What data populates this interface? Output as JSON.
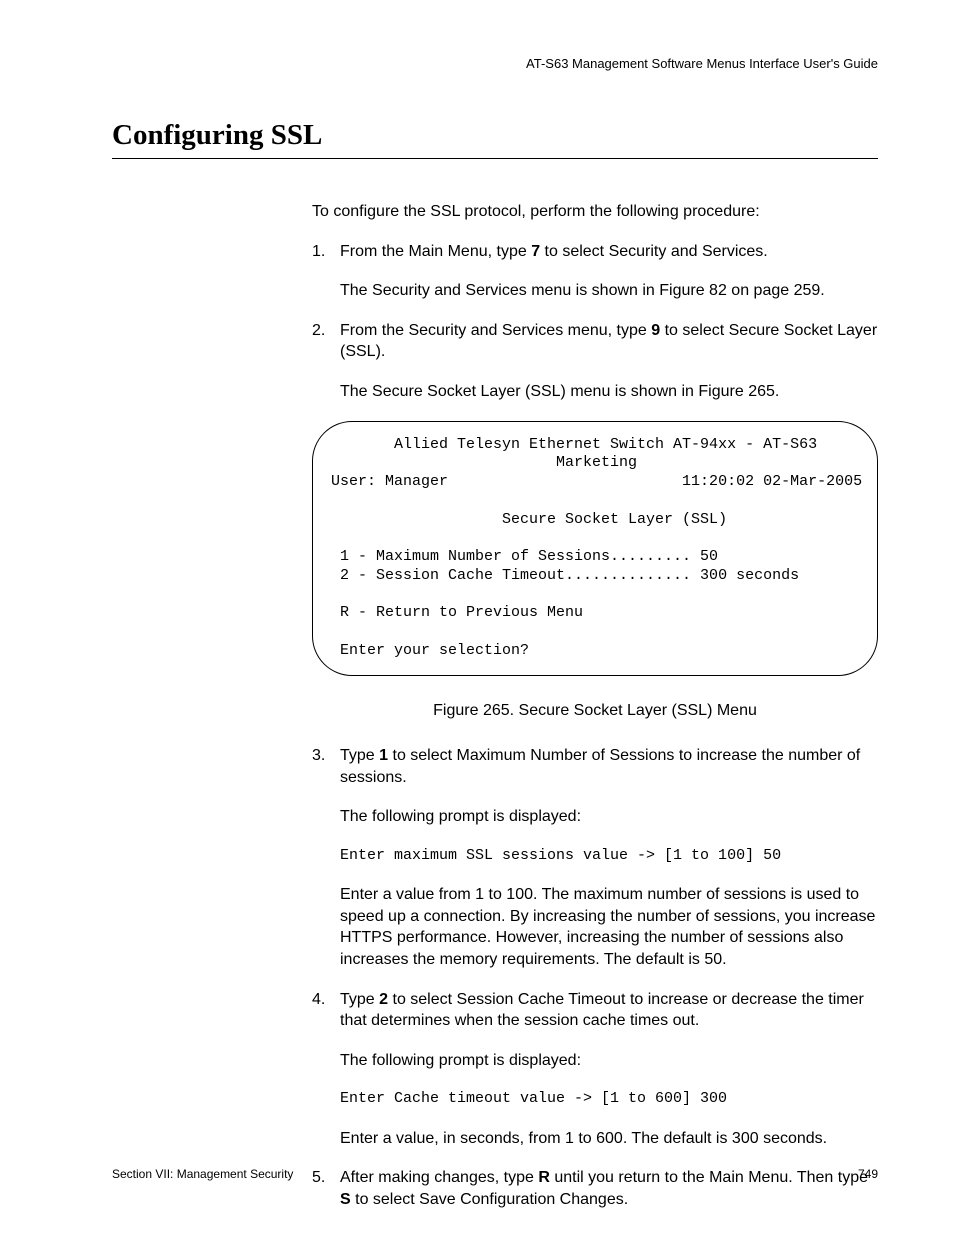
{
  "header": {
    "guide_title": "AT-S63 Management Software Menus Interface User's Guide"
  },
  "title": "Configuring SSL",
  "intro": "To configure the SSL protocol, perform the following procedure:",
  "steps": {
    "s1_pre": "From the Main Menu, type ",
    "s1_bold": "7",
    "s1_post": " to select Security and Services.",
    "s1_sub": "The Security and Services menu is shown in Figure 82 on page 259.",
    "s2_pre": "From the Security and Services menu, type ",
    "s2_bold": "9",
    "s2_post": " to select Secure Socket Layer (SSL).",
    "s2_sub": "The Secure Socket Layer (SSL) menu is shown in Figure 265.",
    "s3_pre": "Type ",
    "s3_bold": "1",
    "s3_post": " to select Maximum Number of Sessions to increase the number of sessions.",
    "s3_sub1": "The following prompt is displayed:",
    "s3_mono": "Enter maximum SSL sessions value -> [1 to 100] 50",
    "s3_sub2": "Enter a value from 1 to 100. The maximum number of sessions is used to speed up a connection. By increasing the number of sessions, you increase HTTPS performance. However, increasing the number of sessions also increases the memory requirements. The default is 50.",
    "s4_pre": "Type ",
    "s4_bold": "2",
    "s4_post": " to select Session Cache Timeout to increase or decrease the timer that determines when the session cache times out.",
    "s4_sub1": "The following prompt is displayed:",
    "s4_mono": "Enter Cache timeout value -> [1 to 600] 300",
    "s4_sub2": "Enter a value, in seconds, from 1 to 600. The default is 300 seconds.",
    "s5_pre": "After making changes, type ",
    "s5_bold1": "R",
    "s5_mid": " until you return to the Main Menu. Then type ",
    "s5_bold2": "S",
    "s5_post": " to select Save Configuration Changes."
  },
  "terminal": {
    "line1": "       Allied Telesyn Ethernet Switch AT-94xx - AT-S63",
    "line2": "                         Marketing",
    "line3": "User: Manager                          11:20:02 02-Mar-2005",
    "line4": "                   Secure Socket Layer (SSL)",
    "blank": "",
    "line5": " 1 - Maximum Number of Sessions......... 50",
    "line6": " 2 - Session Cache Timeout.............. 300 seconds",
    "line7": " R - Return to Previous Menu",
    "line8": " Enter your selection?"
  },
  "caption": "Figure 265. Secure Socket Layer (SSL) Menu",
  "footer": {
    "section": "Section VII: Management Security",
    "page": "749"
  }
}
